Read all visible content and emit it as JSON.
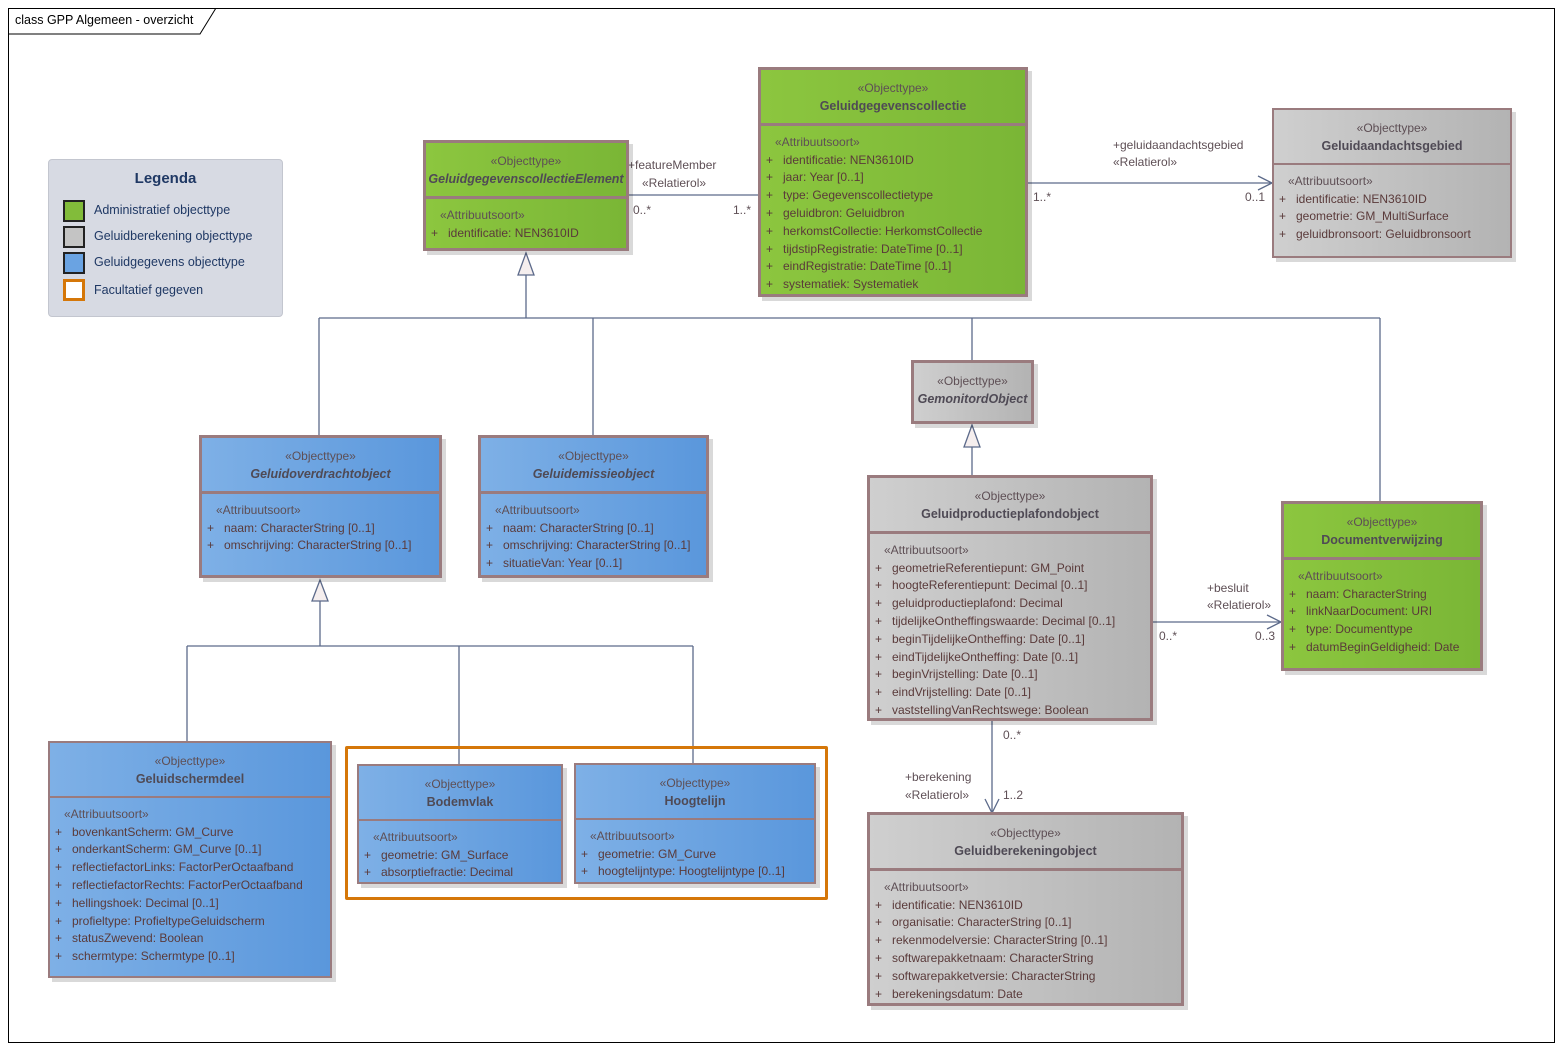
{
  "diagram": {
    "title": "class GPP Algemeen - overzicht"
  },
  "legend": {
    "title": "Legenda",
    "items": [
      {
        "label": "Administratief objecttype",
        "color": "#82bc3a",
        "border": "#222222"
      },
      {
        "label": "Geluidberekening objecttype",
        "color": "#c4c4c4",
        "border": "#222222"
      },
      {
        "label": "Geluidgegevens objecttype",
        "color": "#6aa3e2",
        "border": "#222222"
      },
      {
        "label": "Facultatief gegeven",
        "color": "#ffffff",
        "border": "#d57709"
      }
    ]
  },
  "colors": {
    "administratief": "#82bc3a",
    "geluidberekening": "#c4c4c4",
    "geluidgegevens": "#6aa3e2",
    "facultatief": "#d57709",
    "connector": "#5c6a8a"
  },
  "classes": {
    "collectieElement": {
      "stereotype": "«Objecttype»",
      "name": "GeluidgegevenscollectieElement",
      "attr_stereotype": "«Attribuutsoort»",
      "attributes": [
        {
          "vis": "+",
          "text": "identificatie: NEN3610ID"
        }
      ]
    },
    "collectie": {
      "stereotype": "«Objecttype»",
      "name": "Geluidgegevenscollectie",
      "attr_stereotype": "«Attribuutsoort»",
      "attributes": [
        {
          "vis": "+",
          "text": "identificatie: NEN3610ID"
        },
        {
          "vis": "+",
          "text": "jaar: Year [0..1]"
        },
        {
          "vis": "+",
          "text": "type: Gegevenscollectietype"
        },
        {
          "vis": "+",
          "text": "geluidbron: Geluidbron"
        },
        {
          "vis": "+",
          "text": "herkomstCollectie: HerkomstCollectie"
        },
        {
          "vis": "+",
          "text": "tijdstipRegistratie: DateTime [0..1]"
        },
        {
          "vis": "+",
          "text": "eindRegistratie: DateTime [0..1]"
        },
        {
          "vis": "+",
          "text": "systematiek: Systematiek"
        }
      ]
    },
    "aandachtsgebied": {
      "stereotype": "«Objecttype»",
      "name": "Geluidaandachtsgebied",
      "attr_stereotype": "«Attribuutsoort»",
      "attributes": [
        {
          "vis": "+",
          "text": "identificatie: NEN3610ID"
        },
        {
          "vis": "+",
          "text": "geometrie: GM_MultiSurface"
        },
        {
          "vis": "+",
          "text": "geluidbronsoort: Geluidbronsoort"
        }
      ]
    },
    "gemonitord": {
      "stereotype": "«Objecttype»",
      "name": "GemonitordObject"
    },
    "overdracht": {
      "stereotype": "«Objecttype»",
      "name": "Geluidoverdrachtobject",
      "attr_stereotype": "«Attribuutsoort»",
      "attributes": [
        {
          "vis": "+",
          "text": "naam: CharacterString [0..1]"
        },
        {
          "vis": "+",
          "text": "omschrijving: CharacterString [0..1]"
        }
      ]
    },
    "emissie": {
      "stereotype": "«Objecttype»",
      "name": "Geluidemissieobject",
      "attr_stereotype": "«Attribuutsoort»",
      "attributes": [
        {
          "vis": "+",
          "text": "naam: CharacterString [0..1]"
        },
        {
          "vis": "+",
          "text": "omschrijving: CharacterString [0..1]"
        },
        {
          "vis": "+",
          "text": "situatieVan: Year [0..1]"
        }
      ]
    },
    "plafond": {
      "stereotype": "«Objecttype»",
      "name": "Geluidproductieplafondobject",
      "attr_stereotype": "«Attribuutsoort»",
      "attributes": [
        {
          "vis": "+",
          "text": "geometrieReferentiepunt: GM_Point"
        },
        {
          "vis": "+",
          "text": "hoogteReferentiepunt: Decimal [0..1]"
        },
        {
          "vis": "+",
          "text": "geluidproductieplafond: Decimal"
        },
        {
          "vis": "+",
          "text": "tijdelijkeOntheffingswaarde: Decimal [0..1]"
        },
        {
          "vis": "+",
          "text": "beginTijdelijkeOntheffing: Date [0..1]"
        },
        {
          "vis": "+",
          "text": "eindTijdelijkeOntheffing: Date [0..1]"
        },
        {
          "vis": "+",
          "text": "beginVrijstelling: Date [0..1]"
        },
        {
          "vis": "+",
          "text": "eindVrijstelling: Date [0..1]"
        },
        {
          "vis": "+",
          "text": "vaststellingVanRechtswege: Boolean"
        }
      ]
    },
    "document": {
      "stereotype": "«Objecttype»",
      "name": "Documentverwijzing",
      "attr_stereotype": "«Attribuutsoort»",
      "attributes": [
        {
          "vis": "+",
          "text": "naam: CharacterString"
        },
        {
          "vis": "+",
          "text": "linkNaarDocument: URI"
        },
        {
          "vis": "+",
          "text": "type: Documenttype"
        },
        {
          "vis": "+",
          "text": "datumBeginGeldigheid: Date"
        }
      ]
    },
    "scherm": {
      "stereotype": "«Objecttype»",
      "name": "Geluidschermdeel",
      "attr_stereotype": "«Attribuutsoort»",
      "attributes": [
        {
          "vis": "+",
          "text": "bovenkantScherm: GM_Curve"
        },
        {
          "vis": "+",
          "text": "onderkantScherm: GM_Curve [0..1]"
        },
        {
          "vis": "+",
          "text": "reflectiefactorLinks: FactorPerOctaafband"
        },
        {
          "vis": "+",
          "text": "reflectiefactorRechts: FactorPerOctaafband"
        },
        {
          "vis": "+",
          "text": "hellingshoek: Decimal [0..1]"
        },
        {
          "vis": "+",
          "text": "profieltype: ProfieltypeGeluidscherm"
        },
        {
          "vis": "+",
          "text": "statusZwevend: Boolean"
        },
        {
          "vis": "+",
          "text": "schermtype: Schermtype [0..1]"
        }
      ]
    },
    "bodemvlak": {
      "stereotype": "«Objecttype»",
      "name": "Bodemvlak",
      "attr_stereotype": "«Attribuutsoort»",
      "attributes": [
        {
          "vis": "+",
          "text": "geometrie: GM_Surface"
        },
        {
          "vis": "+",
          "text": "absorptiefractie: Decimal"
        }
      ]
    },
    "hoogtelijn": {
      "stereotype": "«Objecttype»",
      "name": "Hoogtelijn",
      "attr_stereotype": "«Attribuutsoort»",
      "attributes": [
        {
          "vis": "+",
          "text": "geometrie: GM_Curve"
        },
        {
          "vis": "+",
          "text": "hoogtelijntype: Hoogtelijntype [0..1]"
        }
      ]
    },
    "berekening": {
      "stereotype": "«Objecttype»",
      "name": "Geluidberekeningobject",
      "attr_stereotype": "«Attribuutsoort»",
      "attributes": [
        {
          "vis": "+",
          "text": "identificatie: NEN3610ID"
        },
        {
          "vis": "+",
          "text": "organisatie: CharacterString [0..1]"
        },
        {
          "vis": "+",
          "text": "rekenmodelversie: CharacterString [0..1]"
        },
        {
          "vis": "+",
          "text": "softwarepakketnaam: CharacterString"
        },
        {
          "vis": "+",
          "text": "softwarepakketversie: CharacterString"
        },
        {
          "vis": "+",
          "text": "berekeningsdatum: Date"
        }
      ]
    }
  },
  "associations": {
    "featureMember": {
      "role": "+featureMember",
      "stereotype": "«Relatierol»",
      "source_mult": "0..*",
      "target_mult": "1..*"
    },
    "aandachtsgebied": {
      "role": "+geluidaandachtsgebied",
      "stereotype": "«Relatierol»",
      "source_mult": "1..*",
      "target_mult": "0..1"
    },
    "besluit": {
      "role": "+besluit",
      "stereotype": "«Relatierol»",
      "source_mult": "0..*",
      "target_mult": "0..3"
    },
    "berekening": {
      "role": "+berekening",
      "stereotype": "«Relatierol»",
      "source_mult": "0..*",
      "target_mult": "1..2"
    }
  }
}
